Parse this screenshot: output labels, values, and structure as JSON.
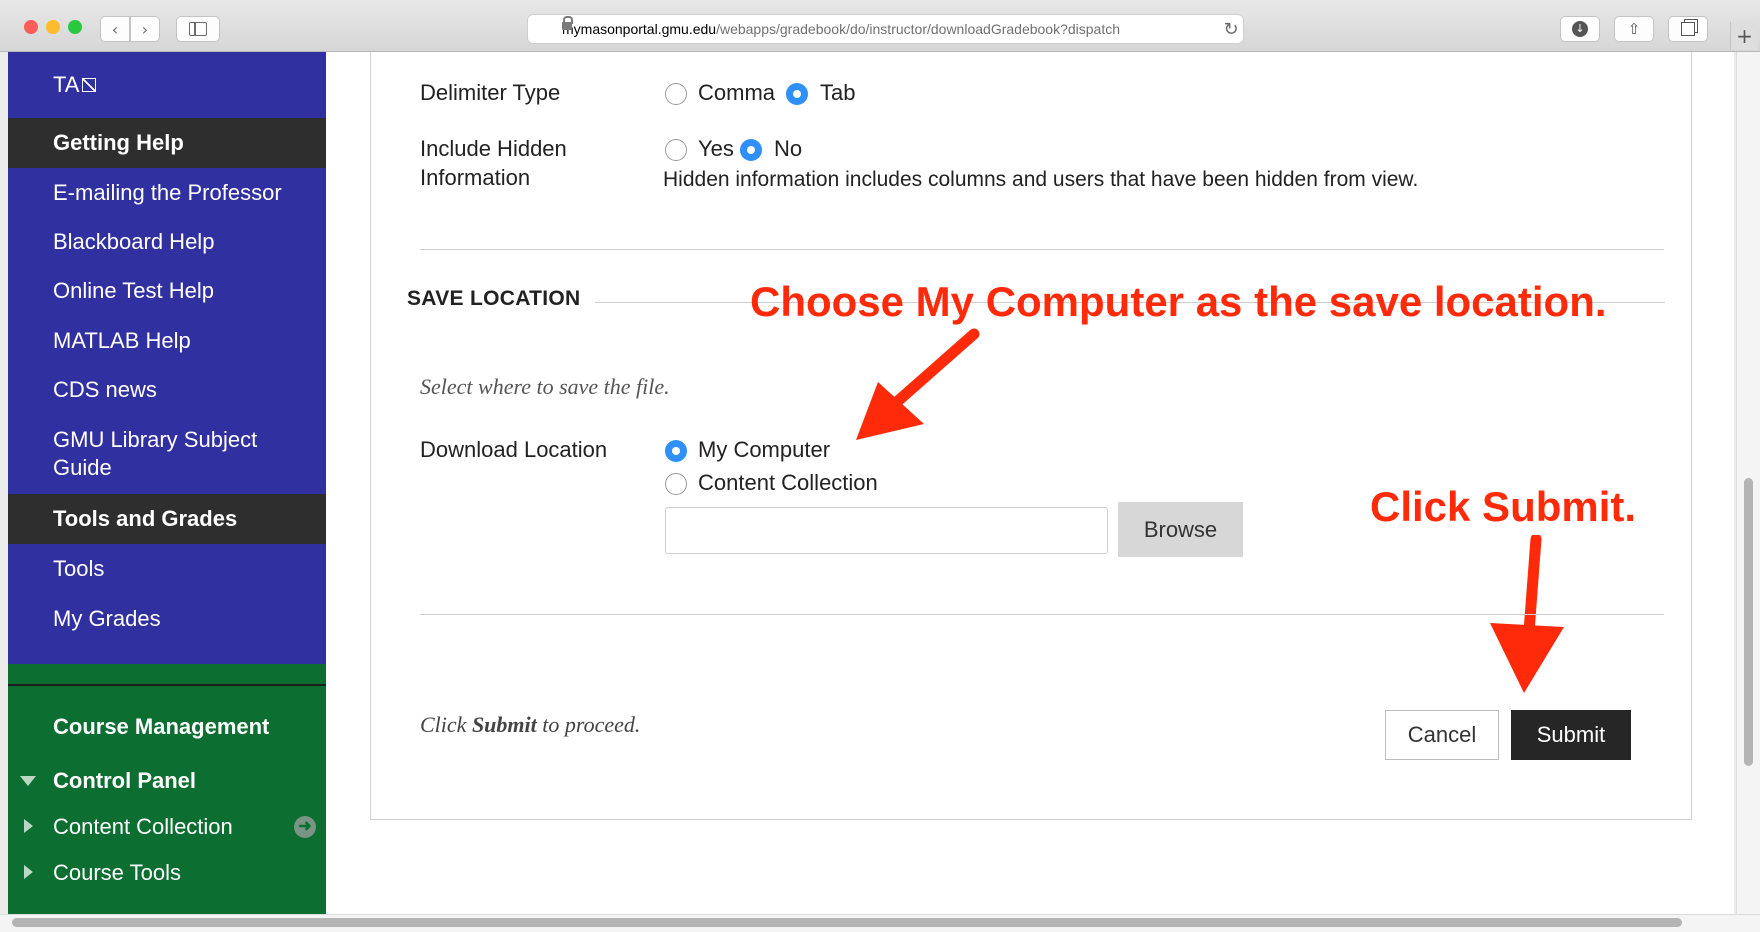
{
  "browser": {
    "url_host": "mymasonportal.gmu.edu",
    "url_path": "/webapps/gradebook/do/instructor/downloadGradebook?dispatch",
    "icons": [
      "back-icon",
      "forward-icon",
      "sidebar-icon",
      "lock-icon",
      "reload-icon",
      "download-icon",
      "share-icon",
      "tabs-icon",
      "new-tab-icon"
    ]
  },
  "sidebar": {
    "ta_label": "TA",
    "getting_help": "Getting Help",
    "help_items": [
      "E-mailing the Professor",
      "Blackboard Help",
      "Online Test Help",
      "MATLAB Help",
      "CDS news",
      "GMU Library Subject",
      "Guide"
    ],
    "tools_and_grades": "Tools and Grades",
    "tools_items": [
      "Tools",
      "My Grades"
    ],
    "course_management": "Course Management",
    "control_panel": "Control Panel",
    "cp_items": [
      "Content Collection",
      "Course Tools"
    ],
    "colors": {
      "nav": "#3130a0",
      "header": "#2e2e2e",
      "manage": "#0d6e32"
    }
  },
  "form": {
    "delimiter_label": "Delimiter Type",
    "delimiter_comma": "Comma",
    "delimiter_tab": "Tab",
    "hidden_label_1": "Include Hidden",
    "hidden_label_2": "Information",
    "hidden_yes": "Yes",
    "hidden_no": "No",
    "hidden_note": "Hidden information includes columns and users that have been hidden from view.",
    "save_location_title": "SAVE LOCATION",
    "save_instructions": "Select where to save the file.",
    "download_label": "Download Location",
    "opt_my_computer": "My Computer",
    "opt_content_collection": "Content Collection",
    "path_value": "",
    "browse_label": "Browse",
    "proceed_pre": "Click ",
    "proceed_bold": "Submit",
    "proceed_post": " to proceed.",
    "cancel_label": "Cancel",
    "submit_label": "Submit",
    "selected": {
      "delimiter": "Tab",
      "hidden": "No",
      "location": "My Computer"
    }
  },
  "annotations": {
    "save_location_note": "Choose My Computer as the save location.",
    "submit_note": "Click Submit.",
    "color": "#ff2a0a"
  }
}
